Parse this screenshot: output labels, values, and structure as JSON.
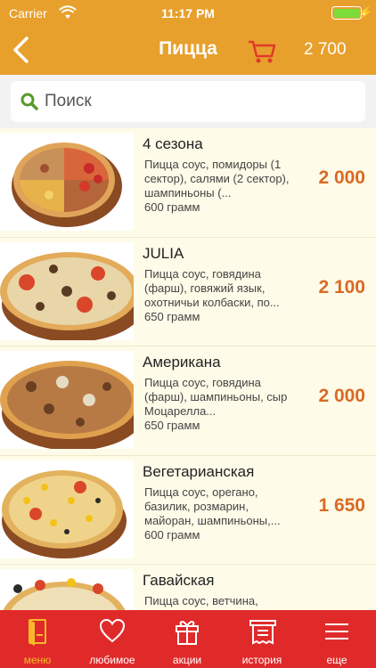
{
  "status_bar": {
    "carrier": "Carrier",
    "time": "11:17 PM"
  },
  "header": {
    "title": "Пицца",
    "cart_total": "2 700"
  },
  "search": {
    "placeholder": "Поиск"
  },
  "items": [
    {
      "name": "4 сезона",
      "description": "Пицца соус, помидоры (1 сектор), салями (2 сектор), шампиньоны (...",
      "weight": "600 грамм",
      "price": "2 000"
    },
    {
      "name": "JULIA",
      "description": "Пицца соус, говядина (фарш), говяжий язык, охотничьи колбаски, по...",
      "weight": "650 грамм",
      "price": "2 100"
    },
    {
      "name": "Американа",
      "description": "Пицца соус, говядина (фарш), шампиньоны, сыр Моцарелла...",
      "weight": "650 грамм",
      "price": "2 000"
    },
    {
      "name": "Вегетарианская",
      "description": "Пицца соус, орегано, базилик, розмарин, майоран, шампиньоны,...",
      "weight": "600 грамм",
      "price": "1 650"
    },
    {
      "name": "Гавайская",
      "description": "Пицца соус, ветчина,",
      "weight": "",
      "price": ""
    }
  ],
  "tabs": [
    {
      "label": "меню",
      "icon": "menu-book-icon"
    },
    {
      "label": "любимое",
      "icon": "heart-icon"
    },
    {
      "label": "акции",
      "icon": "gift-icon"
    },
    {
      "label": "история",
      "icon": "receipt-icon"
    },
    {
      "label": "еще",
      "icon": "hamburger-icon"
    }
  ],
  "colors": {
    "header": "#e8a02c",
    "accent_price": "#d96a24",
    "tabbar": "#e02a2a",
    "active_tab": "#f7b92a",
    "cart_icon": "#e03a2a",
    "search_icon": "#5a9a2a"
  }
}
